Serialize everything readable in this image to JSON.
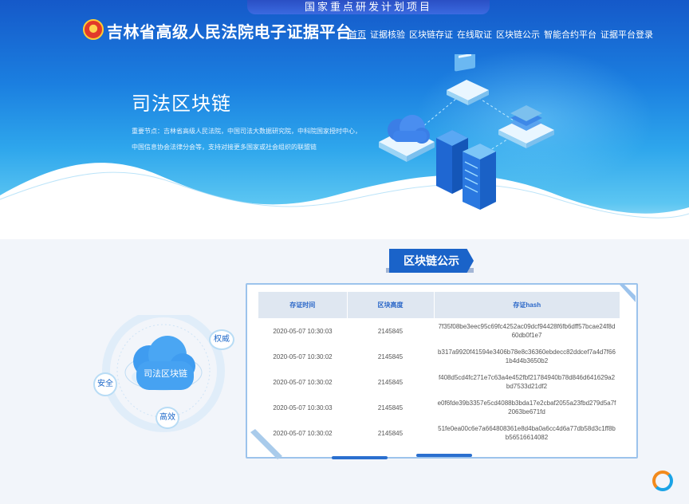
{
  "banner": {
    "text": "国家重点研发计划项目"
  },
  "header": {
    "site_title": "吉林省高级人民法院电子证据平台",
    "nav": [
      "首页",
      "证据核验",
      "区块链存证",
      "在线取证",
      "区块链公示",
      "智能合约平台",
      "证据平台登录"
    ]
  },
  "hero": {
    "heading": "司法区块链",
    "desc_line1": "重要节点：吉林省高级人民法院，中国司法大数据研究院，中科院国家授时中心，",
    "desc_line2": "中国信息协会法律分会等，支持对接更多国家或社会组织的联盟链"
  },
  "publicity": {
    "tab_label": "区块链公示",
    "cloud_label": "司法区块链",
    "badges": {
      "authority": "权威",
      "security": "安全",
      "efficiency": "高效"
    },
    "columns": [
      "存证时间",
      "区块高度",
      "存证hash"
    ],
    "rows": [
      {
        "time": "2020-05-07 10:30:03",
        "height": "2145845",
        "hash": "7f35f08be3eec95c69fc4252ac09dcf94428f6fb6dff57bcae24f8d60db0f1e7"
      },
      {
        "time": "2020-05-07 10:30:02",
        "height": "2145845",
        "hash": "b317a9920f41594e3406b78e8c36360ebdecc82ddcef7a4d7f661b4d4b3650b2"
      },
      {
        "time": "2020-05-07 10:30:02",
        "height": "2145845",
        "hash": "f408d5cd4fc271e7c63a4e452fbf21784940b78d846d641629a2bd7533d21df2"
      },
      {
        "time": "2020-05-07 10:30:03",
        "height": "2145845",
        "hash": "e0f6fde39b3357e5cd4088b3bda17e2cbaf2055a23fbd279d5a7f2063be671fd"
      },
      {
        "time": "2020-05-07 10:30:02",
        "height": "2145845",
        "hash": "51fe0ea00c6e7a664808361e8d4ba0a6cc4d6a77db58d3c1ff8bb56516614082"
      }
    ]
  },
  "colors": {
    "primary": "#1a63c9",
    "accent": "#2a67c8",
    "loader_orange": "#f28a1c",
    "loader_blue": "#1aa3e6"
  }
}
